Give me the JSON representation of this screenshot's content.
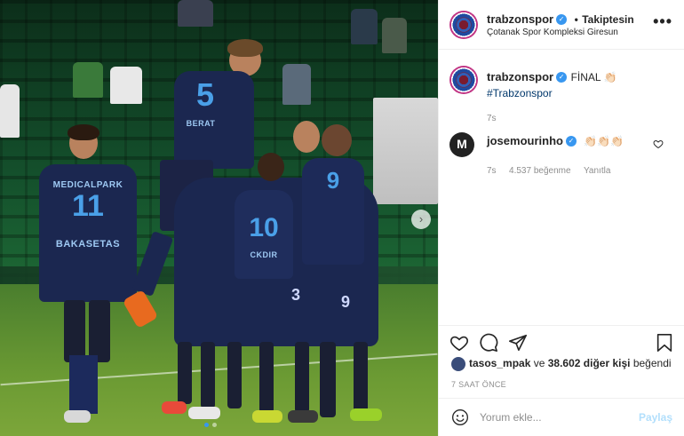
{
  "photo": {
    "alt_players": [
      {
        "number": "5",
        "name": "BERAT"
      },
      {
        "number": "11",
        "name": "BAKASETAS",
        "sponsor": "MEDICALPARK"
      },
      {
        "number": "10",
        "name": "CKDIR"
      },
      {
        "number": "3",
        "name": ""
      },
      {
        "number": "9",
        "name": ""
      }
    ],
    "next_arrow": "›"
  },
  "header": {
    "username": "trabzonspor",
    "separator": "•",
    "follow_status": "Takiptesin",
    "location": "Çotanak Spor Kompleksi Giresun",
    "more": "•••"
  },
  "caption": {
    "username": "trabzonspor",
    "text": "FİNAL 👏🏻",
    "hashtag": "#Trabzonspor",
    "time": "7s"
  },
  "comment": {
    "username": "josemourinho",
    "avatar_letter": "M",
    "text": "👏🏻👏🏻👏🏻",
    "time": "7s",
    "likes": "4.537 beğenme",
    "reply": "Yanıtla"
  },
  "actions": {
    "like_icon": "heart-icon",
    "comment_icon": "comment-icon",
    "share_icon": "share-icon",
    "save_icon": "bookmark-icon"
  },
  "likes": {
    "first_liker": "tasos_mpak",
    "connector": "ve",
    "others": "38.602 diğer kişi",
    "suffix": "beğendi"
  },
  "time_ago": "7 SAAT ÖNCE",
  "comment_box": {
    "emoji_icon": "emoji-icon",
    "placeholder": "Yorum ekle...",
    "post_label": "Paylaş"
  },
  "colors": {
    "verified": "#3897f0",
    "link": "#00376b",
    "muted": "#8e8e8e",
    "post_disabled": "#b2dffc",
    "jersey": "#1b2750"
  }
}
